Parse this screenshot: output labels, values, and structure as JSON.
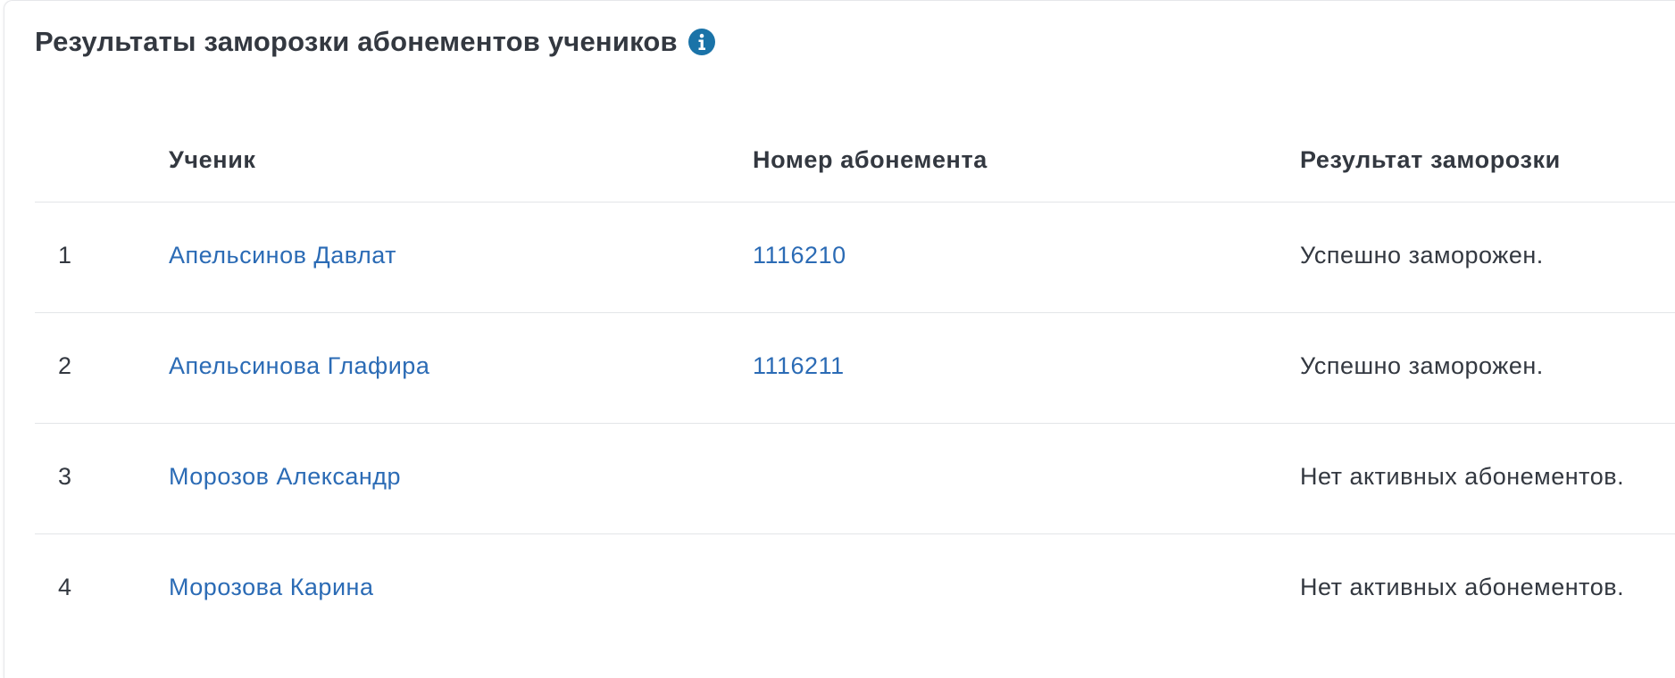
{
  "header": {
    "title": "Результаты заморозки абонементов учеников",
    "info_icon": "info-circle-icon",
    "info_icon_color": "#1a73a8"
  },
  "table": {
    "columns": [
      "",
      "Ученик",
      "Номер абонемента",
      "Результат заморозки"
    ],
    "rows": [
      {
        "num": "1",
        "student": "Апельсинов Давлат",
        "subscription": "1116210",
        "result": "Успешно заморожен."
      },
      {
        "num": "2",
        "student": "Апельсинова Глафира",
        "subscription": "1116211",
        "result": "Успешно заморожен."
      },
      {
        "num": "3",
        "student": "Морозов Александр",
        "subscription": "",
        "result": "Нет активных абонементов."
      },
      {
        "num": "4",
        "student": "Морозова Карина",
        "subscription": "",
        "result": "Нет активных абонементов."
      }
    ]
  },
  "colors": {
    "link": "#2b6bb5",
    "text": "#333840",
    "divider": "#e3e5e8"
  }
}
